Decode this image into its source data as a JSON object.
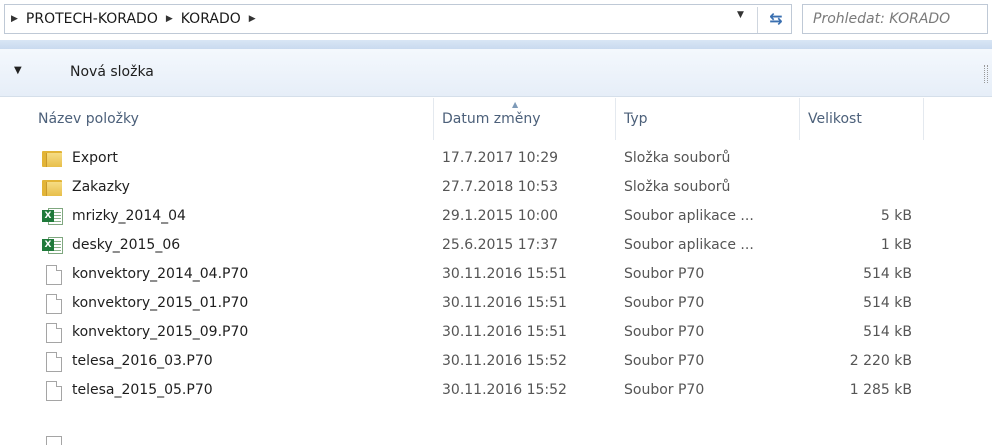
{
  "address": {
    "crumbs": [
      "PROTECH-KORADO",
      "KORADO"
    ],
    "search_placeholder": "Prohledat: KORADO"
  },
  "toolbar": {
    "new_folder_label": "Nová složka"
  },
  "columns": {
    "name": "Název položky",
    "date": "Datum změny",
    "type": "Typ",
    "size": "Velikost"
  },
  "files": [
    {
      "icon": "folder-icon",
      "name": "Export",
      "date": "17.7.2017 10:29",
      "type": "Složka souborů",
      "size": ""
    },
    {
      "icon": "folder-icon",
      "name": "Zakazky",
      "date": "27.7.2018 10:53",
      "type": "Složka souborů",
      "size": ""
    },
    {
      "icon": "excel-file-icon",
      "name": "mrizky_2014_04",
      "date": "29.1.2015 10:00",
      "type": "Soubor aplikace ...",
      "size": "5 kB"
    },
    {
      "icon": "excel-file-icon",
      "name": "desky_2015_06",
      "date": "25.6.2015 17:37",
      "type": "Soubor aplikace ...",
      "size": "1 kB"
    },
    {
      "icon": "generic-file-icon",
      "name": "konvektory_2014_04.P70",
      "date": "30.11.2016 15:51",
      "type": "Soubor P70",
      "size": "514 kB"
    },
    {
      "icon": "generic-file-icon",
      "name": "konvektory_2015_01.P70",
      "date": "30.11.2016 15:51",
      "type": "Soubor P70",
      "size": "514 kB"
    },
    {
      "icon": "generic-file-icon",
      "name": "konvektory_2015_09.P70",
      "date": "30.11.2016 15:51",
      "type": "Soubor P70",
      "size": "514 kB"
    },
    {
      "icon": "generic-file-icon",
      "name": "telesa_2016_03.P70",
      "date": "30.11.2016 15:52",
      "type": "Soubor P70",
      "size": "2 220 kB"
    },
    {
      "icon": "generic-file-icon",
      "name": "telesa_2015_05.P70",
      "date": "30.11.2016 15:52",
      "type": "Soubor P70",
      "size": "1 285 kB"
    }
  ]
}
